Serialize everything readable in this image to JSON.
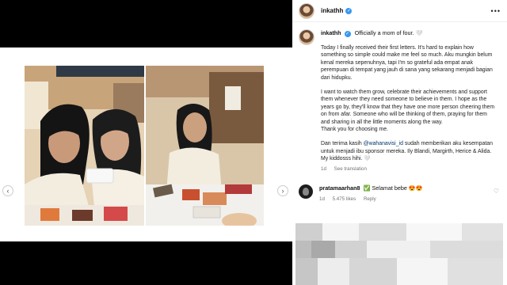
{
  "post": {
    "username": "inkathh",
    "verified_badge": "✓",
    "more_icon": "•••",
    "caption_headline": "Officially a mom of four. 🤍",
    "paragraphs": [
      "Today I finally received their first letters. It's hard to explain how something so simple could make me feel so much. Aku mungkin belum kenal mereka sepenuhnya, tapi I'm so grateful ada empat anak perempuan di tempat yang jauh di sana yang sekarang menjadi bagian dari hidupku.",
      "I want to watch them grow, celebrate their achievements and support them whenever they need someone to believe in them. I hope as the years go by, they'll know that they have one more person cheering them on from afar. Someone who will be thinking of them, praying for them and sharing in all the little moments along the way.",
      "Thank you for choosing me."
    ],
    "para_last_pre": "Dan terima kasih ",
    "para_last_handle": "@wahanavisi_id",
    "para_last_post": " sudah memberikan aku kesempatan untuk menjadi ibu sponsor mereka. Ily Blandi, Margirth, Herice & Alida. My kiddosss hihi. 🤍",
    "age": "1d",
    "see_translation": "See translation"
  },
  "comment": {
    "username": "pratamaarhan8",
    "text": "✅ Selamat bebe 😍😍",
    "age": "1d",
    "likes": "5.475 likes",
    "reply": "Reply",
    "heart_icon": "♡"
  },
  "carousel": {
    "prev_icon": "‹",
    "next_icon": "›"
  },
  "colors": {
    "verified": "#3897f0",
    "link": "#00376b",
    "muted": "#737373"
  }
}
